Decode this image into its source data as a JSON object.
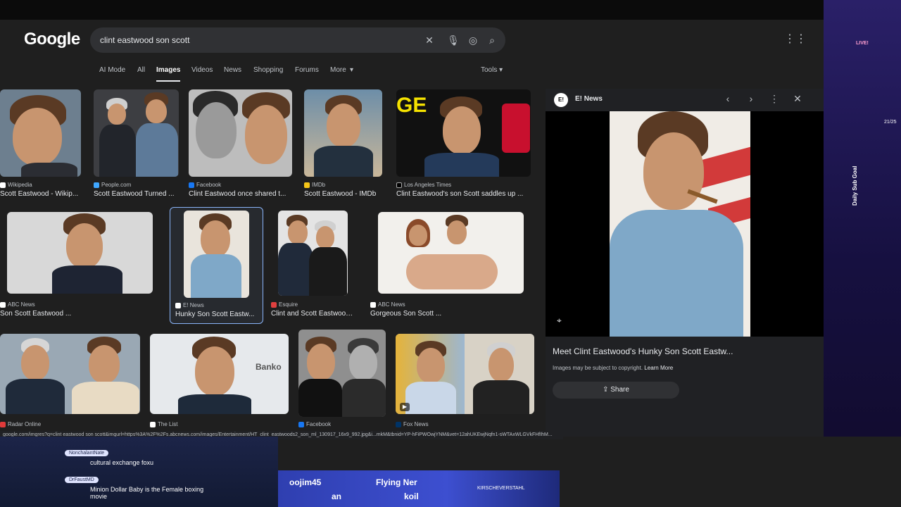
{
  "header": {
    "logo": "Google",
    "query": "clint eastwood son scott"
  },
  "tabs": [
    "AI Mode",
    "All",
    "Images",
    "Videos",
    "News",
    "Shopping",
    "Forums",
    "More"
  ],
  "tools": "Tools",
  "results": [
    {
      "source": "Wikipedia",
      "title": "Scott Eastwood - Wikip..."
    },
    {
      "source": "People.com",
      "title": "Scott Eastwood Turned ..."
    },
    {
      "source": "Facebook",
      "title": "Clint Eastwood once shared t..."
    },
    {
      "source": "IMDb",
      "title": "Scott Eastwood - IMDb"
    },
    {
      "source": "Los Angeles Times",
      "title": "Clint Eastwood's son Scott saddles up ..."
    },
    {
      "source": "ABC News",
      "title": "Son Scott Eastwood ..."
    },
    {
      "source": "E! News",
      "title": "Hunky Son Scott Eastw..."
    },
    {
      "source": "Esquire",
      "title": "Clint and Scott Eastwood ..."
    },
    {
      "source": "ABC News",
      "title": "Gorgeous Son Scott ..."
    },
    {
      "source": "Radar Online",
      "title": ""
    },
    {
      "source": "The List",
      "title": ""
    },
    {
      "source": "Facebook",
      "title": ""
    },
    {
      "source": "Fox News",
      "title": ""
    }
  ],
  "panel": {
    "source": "E! News",
    "source_icon": "E!",
    "title": "Meet Clint Eastwood's Hunky Son Scott Eastw...",
    "copyright_note": "Images may be subject to copyright.",
    "learn_more": "Learn More",
    "share": "Share"
  },
  "status_url": "google.com/imgres?q=clint eastwood son scott&imgurl=https%3A%2F%2Fs.abcnews.com/images/Entertainment/HT_clint_eastwoods2_son_ml_130917_16x9_992.jpg&i...mkM&tbnid=YP-hFiPWOwjYNM&vet=12ahUKEwjNqfn1-sWTAxWLGVkFHfIhM...",
  "stream": {
    "chat": [
      {
        "user": "NonchalantNate",
        "text": "cultural exchange foxu"
      },
      {
        "user": "DrFaustMD",
        "text": "Minion Dollar Baby is the Female boxing movie"
      }
    ],
    "ticker": {
      "a": "oojim45",
      "b": "Flying Ner",
      "c": "an",
      "d": "koil",
      "e": "KIRSCHEVERSTAHL"
    },
    "live_label": "LIVE!",
    "sub_goal_label": "Daily Sub Goal",
    "sub_goal_count": "21/25"
  },
  "colors": {
    "page_bg": "#1f1f1f",
    "search_bg": "#303134",
    "accent": "#8ab4f8"
  }
}
